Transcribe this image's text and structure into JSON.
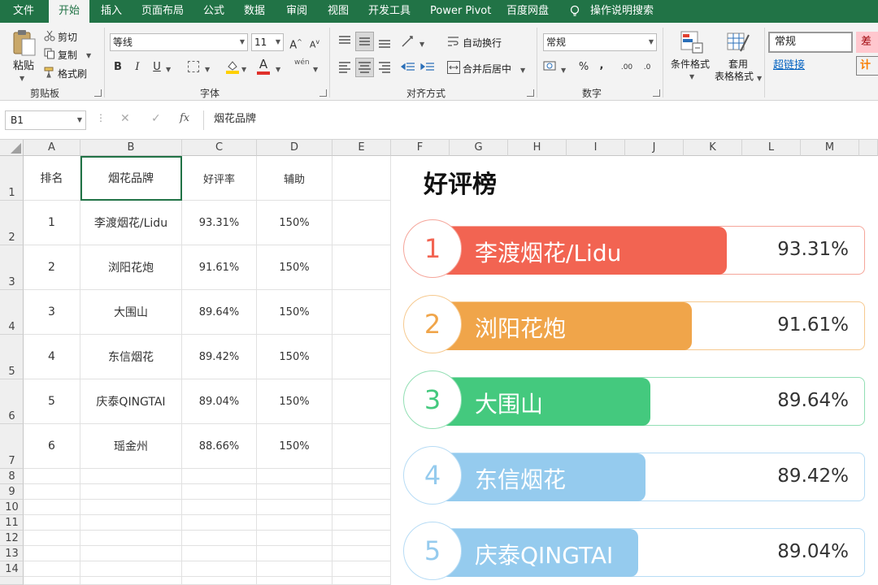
{
  "menu": {
    "tabs": [
      "文件",
      "开始",
      "插入",
      "页面布局",
      "公式",
      "数据",
      "审阅",
      "视图",
      "开发工具",
      "Power Pivot",
      "百度网盘"
    ],
    "active_tab": "开始",
    "tell_me": "操作说明搜索"
  },
  "ribbon": {
    "clipboard": {
      "paste": "粘贴",
      "cut": "剪切",
      "copy": "复制",
      "format_painter": "格式刷",
      "group": "剪贴板"
    },
    "font": {
      "name": "等线",
      "size": "11",
      "grow": "A",
      "shrink": "A",
      "bold": "B",
      "italic": "I",
      "underline": "U",
      "font_color_letter": "A",
      "phonetic": "wén",
      "group": "字体"
    },
    "alignment": {
      "wrap": "自动换行",
      "merge": "合并后居中",
      "group": "对齐方式"
    },
    "number": {
      "format": "常规",
      "percent": "%",
      "comma": ",",
      "inc_decimal": ".00",
      "dec_decimal": ".0",
      "group": "数字"
    },
    "styles": {
      "conditional": "条件格式",
      "table_format_line1": "套用",
      "table_format_line2": "表格格式",
      "style_normal": "常规",
      "style_hyperlink": "超链接",
      "style_bad": "差",
      "style_calc": "计算"
    }
  },
  "formula_bar": {
    "name_box": "B1",
    "cancel": "✕",
    "enter": "✓",
    "fx": "fx",
    "content": "烟花品牌"
  },
  "columns": [
    "A",
    "B",
    "C",
    "D",
    "E",
    "F",
    "G",
    "H",
    "I",
    "J",
    "K",
    "L",
    "M"
  ],
  "rows": [
    "1",
    "2",
    "3",
    "4",
    "5",
    "6",
    "7",
    "8",
    "9",
    "10",
    "11",
    "12",
    "13",
    "14"
  ],
  "table": {
    "headers": [
      "排名",
      "烟花品牌",
      "好评率",
      "辅助"
    ],
    "rows": [
      [
        "1",
        "李渡烟花/Lidu",
        "93.31%",
        "150%"
      ],
      [
        "2",
        "浏阳花炮",
        "91.61%",
        "150%"
      ],
      [
        "3",
        "大围山",
        "89.64%",
        "150%"
      ],
      [
        "4",
        "东信烟花",
        "89.42%",
        "150%"
      ],
      [
        "5",
        "庆泰QINGTAI",
        "89.04%",
        "150%"
      ],
      [
        "6",
        "瑶金州",
        "88.66%",
        "150%"
      ]
    ]
  },
  "chart": {
    "title": "好评榜",
    "colors": [
      "#f26452",
      "#f0a54a",
      "#44c97e",
      "#95cbee",
      "#95cbee"
    ],
    "light_colors": [
      "#f5a59a",
      "#f6c98f",
      "#92dfb4",
      "#b7dcf5",
      "#b7dcf5"
    ]
  },
  "chart_data": {
    "type": "bar",
    "title": "好评榜",
    "categories": [
      "李渡烟花/Lidu",
      "浏阳花炮",
      "大围山",
      "东信烟花",
      "庆泰QINGTAI"
    ],
    "ranks": [
      "1",
      "2",
      "3",
      "4",
      "5"
    ],
    "values": [
      93.31,
      91.61,
      89.64,
      89.42,
      89.04
    ],
    "labels": [
      "93.31%",
      "91.61%",
      "89.64%",
      "89.42%",
      "89.04%"
    ],
    "xlim": [
      0,
      150
    ]
  }
}
